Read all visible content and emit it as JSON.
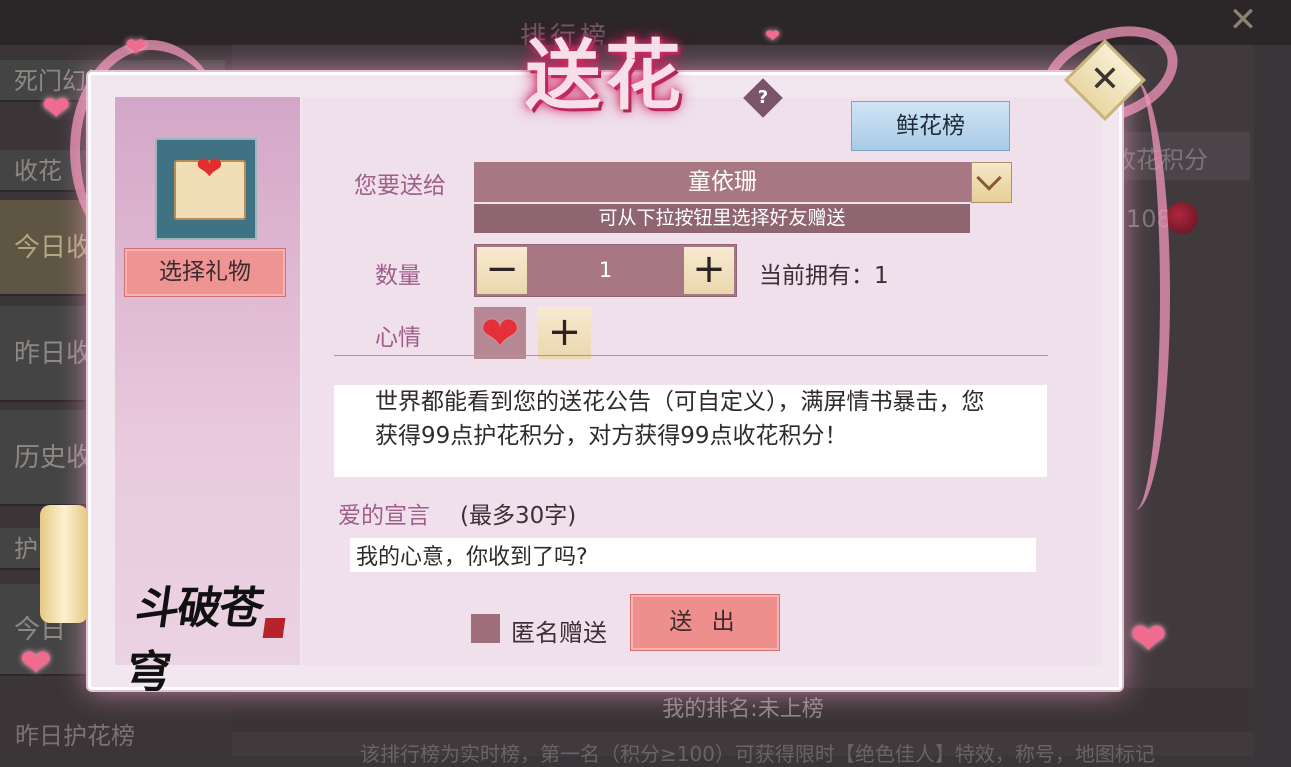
{
  "background": {
    "title": "排行榜",
    "left_tabs": [
      "死门幻境",
      "收花",
      "今日收",
      "昨日收",
      "历史收",
      "护",
      "今日",
      "昨日护花榜"
    ],
    "column_header": "收花积分",
    "row_value": "108",
    "my_rank": "我的排名:未上榜",
    "footer_text": "该排行榜为实时榜，第一名（积分≥100）可获得限时【绝色佳人】特效，称号，地图标记"
  },
  "dialog": {
    "title": "送花",
    "help_symbol": "?",
    "close_symbol": "✕",
    "flower_rank_button": "鲜花榜",
    "select_gift_button": "选择礼物",
    "logo_text": "斗破苍穹",
    "send_to_label": "您要送给",
    "recipient_name": "童依珊",
    "recipient_hint": "可从下拉按钮里选择好友赠送",
    "quantity_label": "数量",
    "quantity_minus": "−",
    "quantity_value": "1",
    "quantity_plus": "+",
    "owned_text": "当前拥有：1",
    "mood_label": "心情",
    "mood_heart": "❤",
    "mood_add": "+",
    "notice_text": "世界都能看到您的送花公告（可自定义），满屏情书暴击，您获得99点护花积分，对方获得99点收花积分！",
    "declaration_label": "爱的宣言",
    "declaration_limit": "(最多30字)",
    "declaration_value": "我的心意，你收到了吗?",
    "anonymous_label": "匿名赠送",
    "send_button": "送 出"
  },
  "colors": {
    "accent_pink": "#ee8f8e",
    "label_purple": "#a05f8b",
    "field_mauve": "#a87784",
    "blue_button": "#a9cbe6"
  }
}
